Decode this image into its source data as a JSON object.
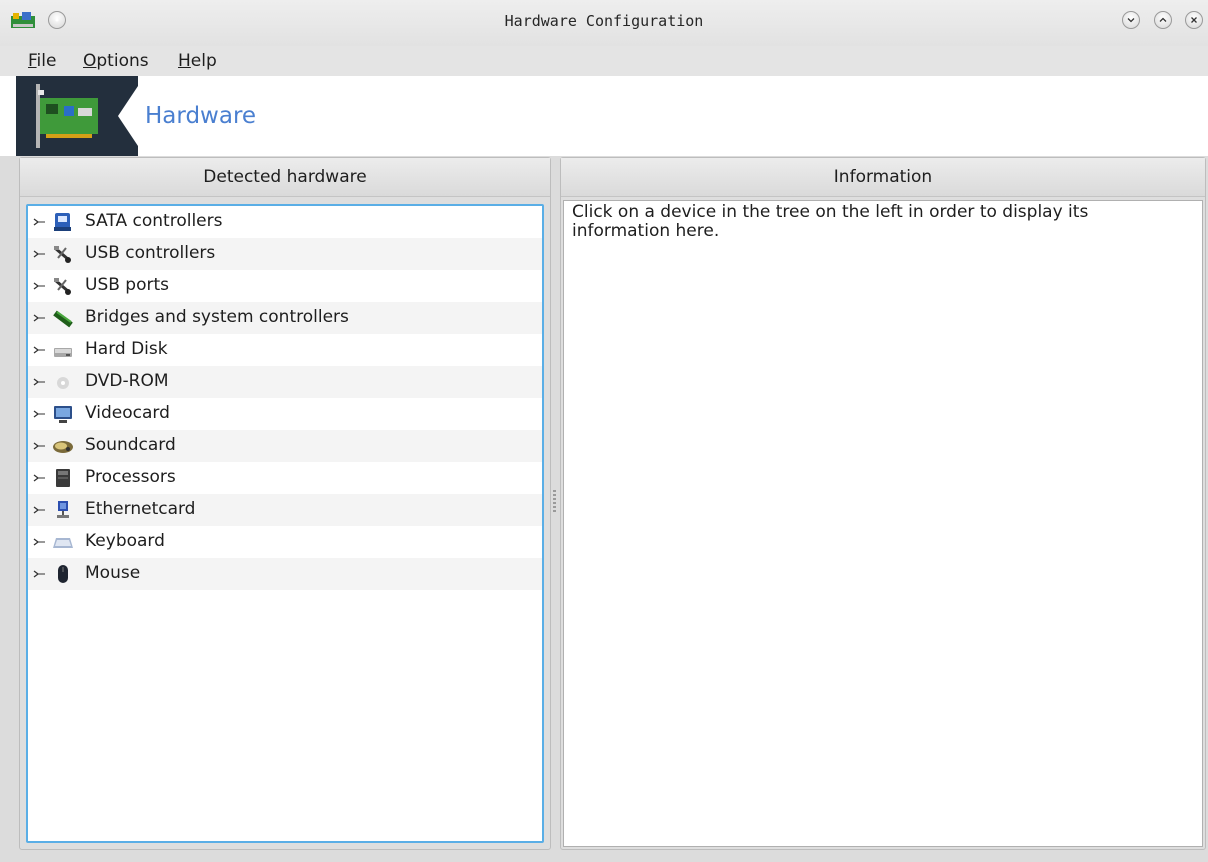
{
  "window": {
    "title": "Hardware Configuration"
  },
  "menu": {
    "file": {
      "mnemonic": "F",
      "rest": "ile"
    },
    "options": {
      "mnemonic": "O",
      "rest": "ptions"
    },
    "help": {
      "mnemonic": "H",
      "rest": "elp"
    }
  },
  "banner": {
    "title": "Hardware"
  },
  "left_panel": {
    "header": "Detected hardware",
    "items": [
      {
        "label": "SATA controllers",
        "icon": "sata-controller-icon"
      },
      {
        "label": "USB controllers",
        "icon": "usb-icon"
      },
      {
        "label": "USB ports",
        "icon": "usb-icon"
      },
      {
        "label": "Bridges and system controllers",
        "icon": "memory-bridge-icon"
      },
      {
        "label": "Hard Disk",
        "icon": "hard-disk-icon"
      },
      {
        "label": "DVD-ROM",
        "icon": "dvd-icon"
      },
      {
        "label": "Videocard",
        "icon": "monitor-icon"
      },
      {
        "label": "Soundcard",
        "icon": "speaker-icon"
      },
      {
        "label": "Processors",
        "icon": "processor-icon"
      },
      {
        "label": "Ethernetcard",
        "icon": "network-icon"
      },
      {
        "label": "Keyboard",
        "icon": "keyboard-icon"
      },
      {
        "label": "Mouse",
        "icon": "mouse-icon"
      }
    ]
  },
  "right_panel": {
    "header": "Information",
    "text": "Click on a device in the tree on the left in order to display its information here."
  },
  "colors": {
    "accent_title": "#4a7fd0",
    "tree_focus_border": "#5aaee6"
  }
}
